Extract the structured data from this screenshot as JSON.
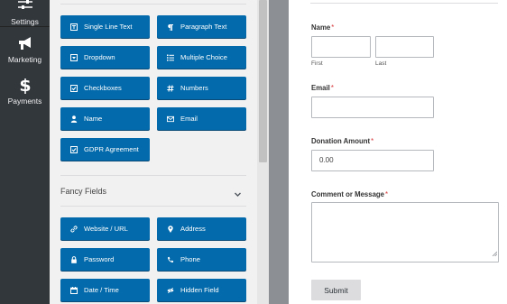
{
  "nav": {
    "items": [
      {
        "label": "Settings",
        "icon": "sliders-icon"
      },
      {
        "label": "Marketing",
        "icon": "megaphone-icon"
      },
      {
        "label": "Payments",
        "icon": "dollar-icon"
      }
    ]
  },
  "standard_fields": [
    {
      "label": "Single Line Text",
      "icon": "text-icon"
    },
    {
      "label": "Paragraph Text",
      "icon": "paragraph-icon"
    },
    {
      "label": "Dropdown",
      "icon": "dropdown-icon"
    },
    {
      "label": "Multiple Choice",
      "icon": "list-icon"
    },
    {
      "label": "Checkboxes",
      "icon": "checkbox-icon"
    },
    {
      "label": "Numbers",
      "icon": "hash-icon"
    },
    {
      "label": "Name",
      "icon": "user-icon"
    },
    {
      "label": "Email",
      "icon": "envelope-icon"
    },
    {
      "label": "GDPR Agreement",
      "icon": "checkbox-icon"
    }
  ],
  "fancy": {
    "title": "Fancy Fields",
    "fields": [
      {
        "label": "Website / URL",
        "icon": "link-icon"
      },
      {
        "label": "Address",
        "icon": "map-pin-icon"
      },
      {
        "label": "Password",
        "icon": "lock-icon"
      },
      {
        "label": "Phone",
        "icon": "phone-icon"
      },
      {
        "label": "Date / Time",
        "icon": "calendar-icon"
      },
      {
        "label": "Hidden Field",
        "icon": "eye-slash-icon"
      }
    ]
  },
  "form": {
    "name_label": "Name",
    "first_sub": "First",
    "last_sub": "Last",
    "email_label": "Email",
    "amount_label": "Donation Amount",
    "amount_value": "0.00",
    "comment_label": "Comment or Message",
    "required_mark": "*",
    "submit_label": "Submit"
  },
  "colors": {
    "nav_bg": "#32373c",
    "button_blue": "#036aab",
    "required_red": "#d63638"
  }
}
